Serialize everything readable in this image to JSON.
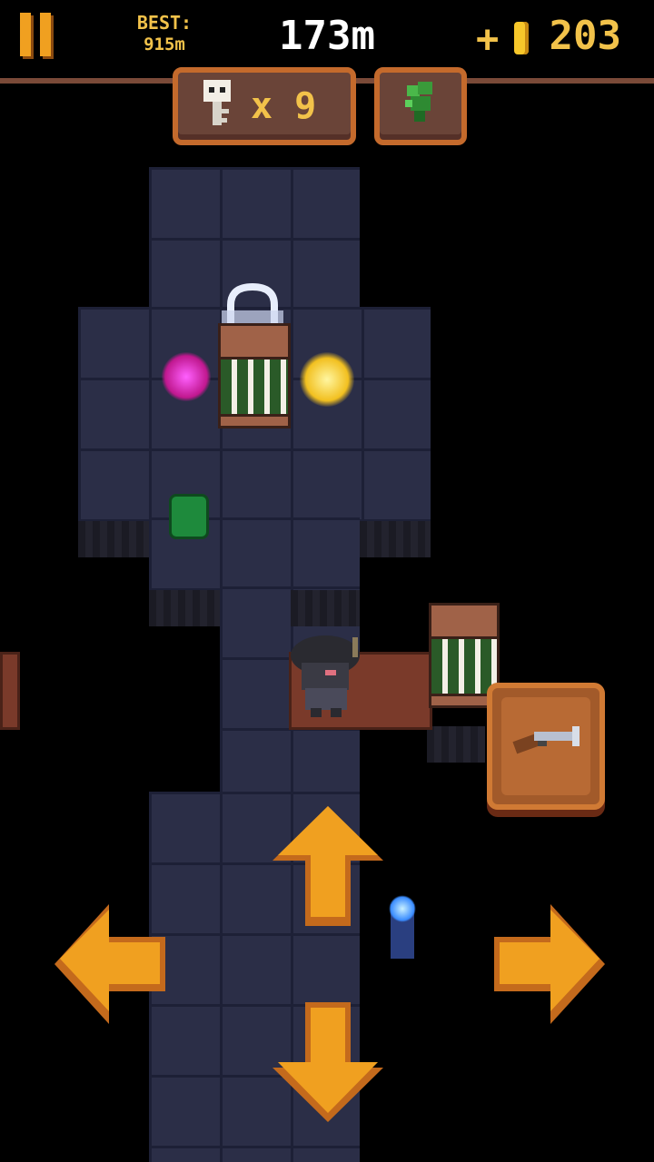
{
  "hud": {
    "best_label": "BEST:",
    "best_value": "915m",
    "distance": "173m",
    "coin_prefix": "+",
    "coins": "203",
    "key_count": "x 9"
  },
  "icons": {
    "pause": "pause-icon",
    "coin": "coin-icon",
    "key": "skull-key-icon",
    "companion": "green-plant-icon",
    "weapon": "blunderbuss-icon"
  },
  "colors": {
    "accent_orange": "#f0a020",
    "gold_text": "#f2c24a",
    "panel_border": "#c46a2c",
    "floor": "#2b2e47"
  }
}
